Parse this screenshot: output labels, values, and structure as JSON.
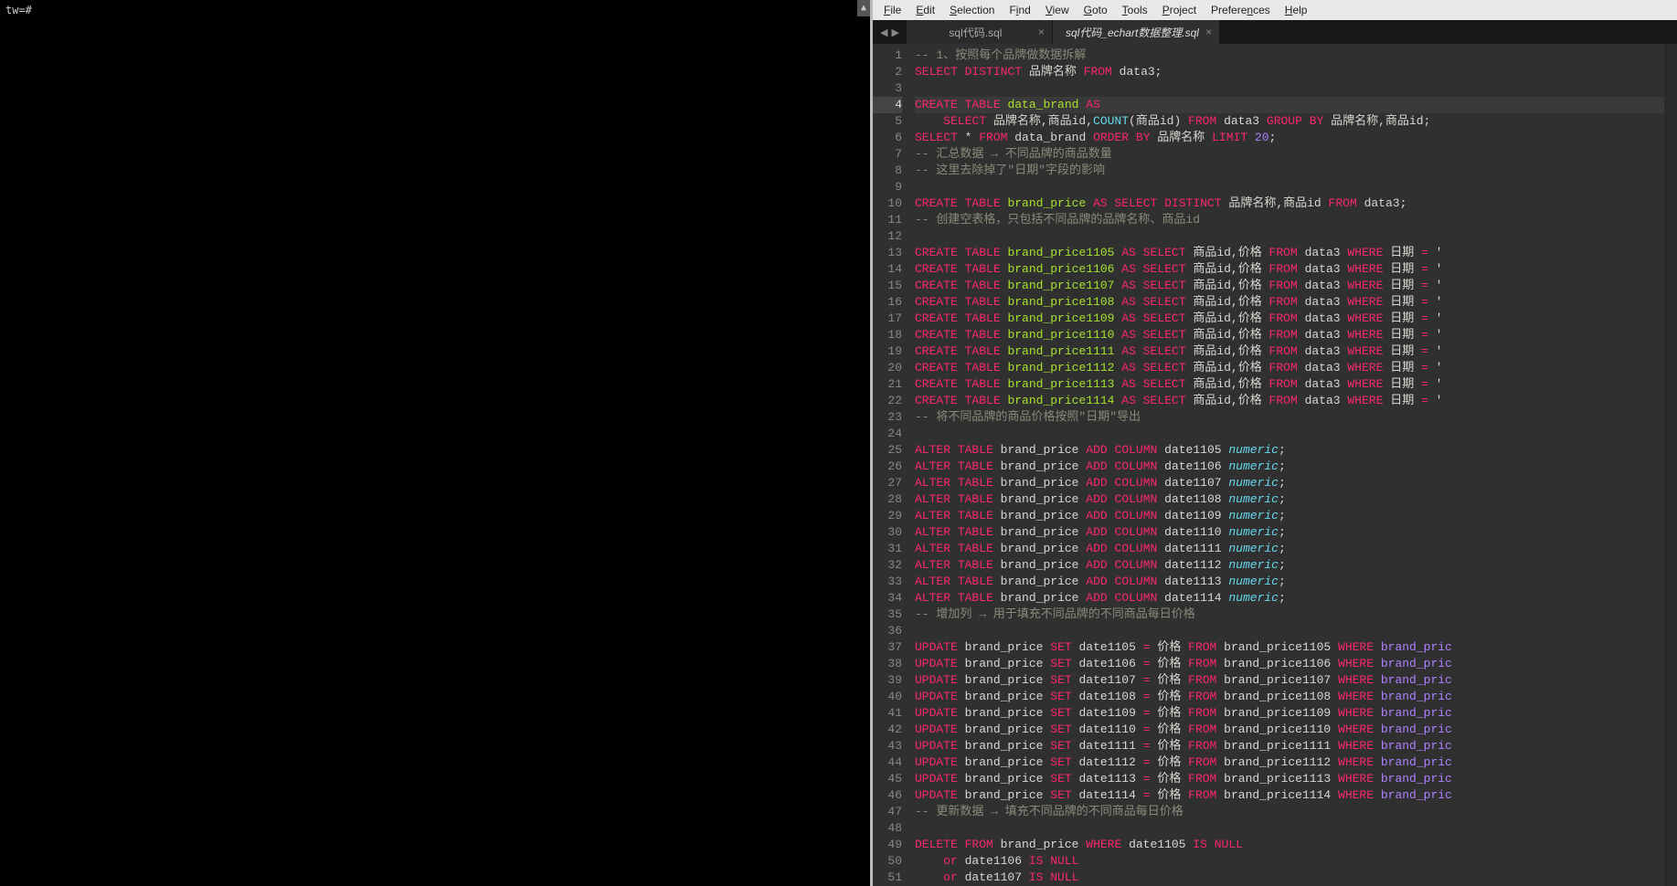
{
  "terminal": {
    "prompt": "tw=#"
  },
  "menu": {
    "file": "File",
    "edit": "Edit",
    "selection": "Selection",
    "find": "Find",
    "view": "View",
    "goto": "Goto",
    "tools": "Tools",
    "project": "Project",
    "preferences": "Preferences",
    "help": "Help"
  },
  "tabs": {
    "inactive": "sql代码.sql",
    "active": "sql代码_echart数据整理.sql"
  },
  "code": {
    "l1_c": "-- 1、按照每个品牌做数据拆解",
    "l2": {
      "a": "SELECT",
      "b": "DISTINCT",
      "c": " 品牌名称 ",
      "d": "FROM",
      "e": " data3;"
    },
    "l4": {
      "a": "CREATE",
      "b": "TABLE",
      "c": " data_brand ",
      "d": "AS"
    },
    "l5": {
      "a": "    SELECT",
      "b": " 品牌名称,商品id,",
      "c": "COUNT",
      "d": "(商品id) ",
      "e": "FROM",
      "f": " data3 ",
      "g": "GROUP",
      "h": "BY",
      "i": " 品牌名称,商品id;"
    },
    "l6": {
      "a": "SELECT",
      "b": " * ",
      "c": "FROM",
      "d": " data_brand ",
      "e": "ORDER",
      "f": "BY",
      "g": " 品牌名称 ",
      "h": "LIMIT",
      "i": " 20",
      ";": ";"
    },
    "l7_c": "-- 汇总数据 → 不同品牌的商品数量",
    "l8_c": "-- 这里去除掉了\"日期\"字段的影响",
    "l10": {
      "a": "CREATE",
      "b": "TABLE",
      "c": " brand_price ",
      "d": "AS",
      "e": "SELECT",
      "f": "DISTINCT",
      "g": " 品牌名称,商品id ",
      "h": "FROM",
      "i": " data3;"
    },
    "l11_c": "-- 创建空表格，只包括不同品牌的品牌名称、商品id",
    "ct": [
      {
        "n": "brand_price1105"
      },
      {
        "n": "brand_price1106"
      },
      {
        "n": "brand_price1107"
      },
      {
        "n": "brand_price1108"
      },
      {
        "n": "brand_price1109"
      },
      {
        "n": "brand_price1110"
      },
      {
        "n": "brand_price1111"
      },
      {
        "n": "brand_price1112"
      },
      {
        "n": "brand_price1113"
      },
      {
        "n": "brand_price1114"
      }
    ],
    "l23_c": "-- 将不同品牌的商品价格按照\"日期\"导出",
    "alter": [
      {
        "c": "date1105"
      },
      {
        "c": "date1106"
      },
      {
        "c": "date1107"
      },
      {
        "c": "date1108"
      },
      {
        "c": "date1109"
      },
      {
        "c": "date1110"
      },
      {
        "c": "date1111"
      },
      {
        "c": "date1112"
      },
      {
        "c": "date1113"
      },
      {
        "c": "date1114"
      }
    ],
    "l35_c": "-- 增加列 → 用于填充不同品牌的不同商品每日价格",
    "upd": [
      {
        "c": "date1105",
        "t": "brand_price1105"
      },
      {
        "c": "date1106",
        "t": "brand_price1106"
      },
      {
        "c": "date1107",
        "t": "brand_price1107"
      },
      {
        "c": "date1108",
        "t": "brand_price1108"
      },
      {
        "c": "date1109",
        "t": "brand_price1109"
      },
      {
        "c": "date1110",
        "t": "brand_price1110"
      },
      {
        "c": "date1111",
        "t": "brand_price1111"
      },
      {
        "c": "date1112",
        "t": "brand_price1112"
      },
      {
        "c": "date1113",
        "t": "brand_price1113"
      },
      {
        "c": "date1114",
        "t": "brand_price1114"
      }
    ],
    "l47_c": "-- 更新数据 → 填充不同品牌的不同商品每日价格",
    "l49": {
      "a": "DELETE",
      "b": "FROM",
      "c": " brand_price ",
      "d": "WHERE",
      "e": " date1105 ",
      "f": "IS",
      "g": "NULL"
    },
    "l50": {
      "a": "    or",
      "b": " date1106 ",
      "c": "IS",
      "d": "NULL"
    },
    "l51": {
      "a": "    or",
      "b": " date1107 ",
      "c": "IS",
      "d": "NULL"
    },
    "tok": {
      "CREATE": "CREATE",
      "TABLE": "TABLE",
      "AS": "AS",
      "SELECT": "SELECT",
      "FROM": "FROM",
      "WHERE": "WHERE",
      "ALTER": "ALTER",
      "ADD": "ADD",
      "COLUMN": "COLUMN",
      "numeric": "numeric",
      "UPDATE": "UPDATE",
      "SET": "SET",
      "brand_price": "brand_price",
      "brand_pric": "brand_pric",
      "fields": " 商品id,价格 ",
      "data3": " data3 ",
      "date": " 日期 ",
      "eq": "=",
      "price": " 价格 ",
      "semi": ";",
      "quote": "'"
    }
  }
}
